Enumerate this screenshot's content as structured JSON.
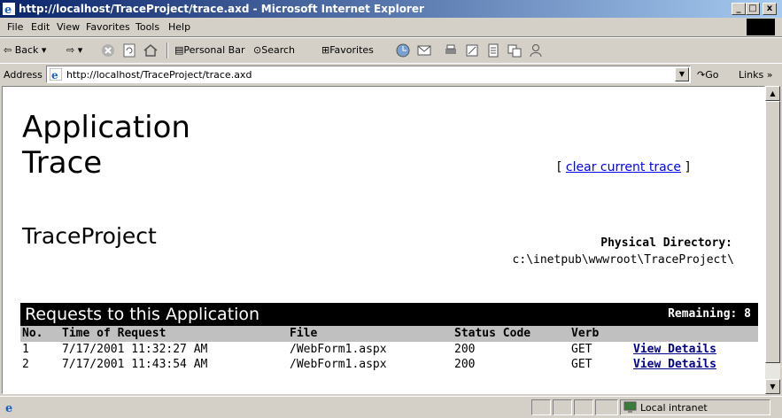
{
  "window": {
    "title": "http://localhost/TraceProject/trace.axd - Microsoft Internet Explorer",
    "min": "_",
    "max": "□",
    "close": "x"
  },
  "menu": [
    "File",
    "Edit",
    "View",
    "Favorites",
    "Tools",
    "Help"
  ],
  "toolbar": {
    "back": "Back",
    "personal_bar": "Personal Bar",
    "search": "Search",
    "favorites": "Favorites"
  },
  "address": {
    "label": "Address",
    "url": "http://localhost/TraceProject/trace.axd",
    "go": "Go",
    "links": "Links »"
  },
  "page": {
    "title_line1": "Application",
    "title_line2": "Trace",
    "project": "TraceProject",
    "clear_open": "[",
    "clear_link": "clear current trace",
    "clear_close": "]",
    "physical_label": "Physical Directory:",
    "physical_value": "c:\\inetpub\\wwwroot\\TraceProject\\"
  },
  "requests": {
    "title": "Requests to this Application",
    "remaining": "Remaining: 8",
    "columns": [
      "No.",
      "Time of Request",
      "File",
      "Status Code",
      "Verb"
    ],
    "rows": [
      {
        "no": "1",
        "time": "7/17/2001 11:32:27 AM",
        "file": "/WebForm1.aspx",
        "status": "200",
        "verb": "GET",
        "link": "View Details"
      },
      {
        "no": "2",
        "time": "7/17/2001 11:43:54 AM",
        "file": "/WebForm1.aspx",
        "status": "200",
        "verb": "GET",
        "link": "View Details"
      }
    ]
  },
  "status": {
    "zone": "Local intranet"
  },
  "colors": {
    "title_bar": "#0a246a",
    "link": "#0000ff",
    "detail_link": "#00008b",
    "header_row": "#c0c0c0"
  }
}
